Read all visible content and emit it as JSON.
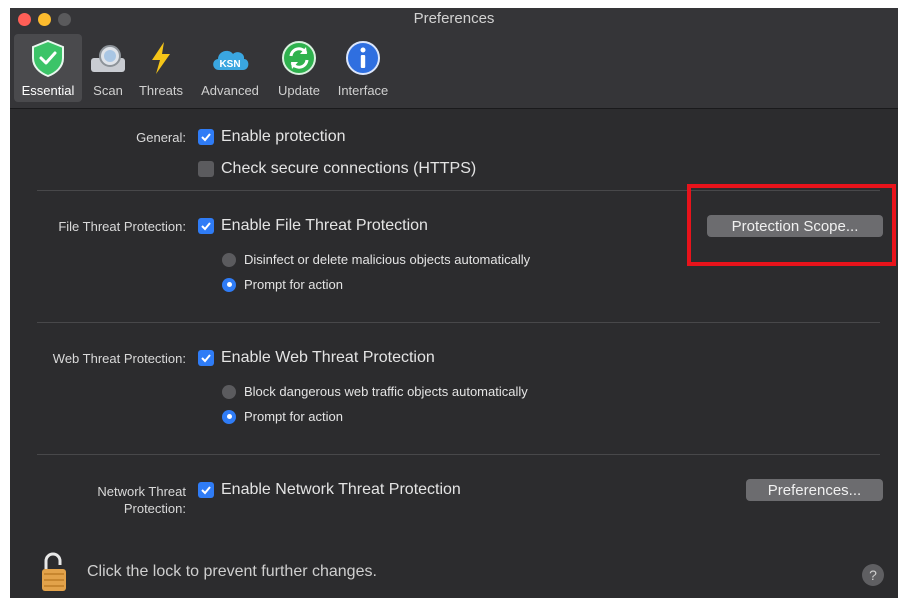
{
  "window": {
    "title": "Preferences"
  },
  "toolbar": {
    "tabs": [
      {
        "label": "Essential",
        "icon": "shield-check-icon",
        "active": true
      },
      {
        "label": "Scan",
        "icon": "scan-icon"
      },
      {
        "label": "Threats",
        "icon": "lightning-icon"
      },
      {
        "label": "Advanced",
        "icon": "ksn-cloud-icon",
        "icon_text": "KSN"
      },
      {
        "label": "Update",
        "icon": "update-icon"
      },
      {
        "label": "Interface",
        "icon": "info-icon"
      }
    ]
  },
  "general": {
    "label": "General:",
    "enable_protection": {
      "label": "Enable protection",
      "checked": true
    },
    "check_https": {
      "label": "Check secure connections (HTTPS)",
      "checked": false
    }
  },
  "file_threat": {
    "label": "File Threat Protection:",
    "enable": {
      "label": "Enable File Threat Protection",
      "checked": true
    },
    "options": [
      {
        "label": "Disinfect or delete malicious objects automatically",
        "selected": false
      },
      {
        "label": "Prompt for action",
        "selected": true
      }
    ],
    "scope_button": "Protection Scope..."
  },
  "web_threat": {
    "label": "Web Threat Protection:",
    "enable": {
      "label": "Enable Web Threat Protection",
      "checked": true
    },
    "options": [
      {
        "label": "Block dangerous web traffic objects automatically",
        "selected": false
      },
      {
        "label": "Prompt for action",
        "selected": true
      }
    ]
  },
  "network_threat": {
    "label_line1": "Network Threat",
    "label_line2": "Protection:",
    "enable": {
      "label": "Enable Network Threat Protection",
      "checked": true
    },
    "prefs_button": "Preferences..."
  },
  "footer": {
    "lock_text": "Click the lock to prevent further changes.",
    "help": "?"
  },
  "colors": {
    "accent": "#2f7cf6",
    "highlight": "#e8131b",
    "background": "#2c2c2e"
  }
}
